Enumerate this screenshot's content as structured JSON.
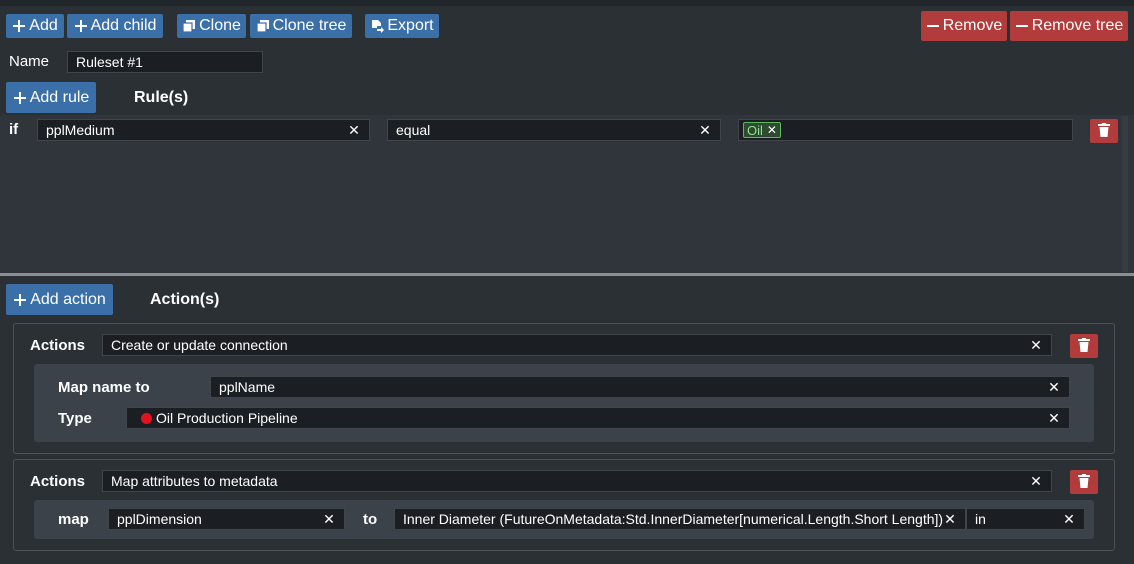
{
  "toolbar": {
    "add": "Add",
    "add_child": "Add child",
    "clone": "Clone",
    "clone_tree": "Clone tree",
    "export": "Export",
    "remove": "Remove",
    "remove_tree": "Remove tree"
  },
  "name": {
    "label": "Name",
    "value": "Ruleset #1"
  },
  "rules": {
    "add_button": "Add rule",
    "heading": "Rule(s)",
    "items": [
      {
        "keyword": "if",
        "field": "pplMedium",
        "operator": "equal",
        "values": [
          "Oil"
        ]
      }
    ]
  },
  "actions": {
    "add_button": "Add action",
    "heading": "Action(s)",
    "items": [
      {
        "label": "Actions",
        "type": "Create or update connection",
        "map_name_label": "Map name to",
        "map_name_value": "pplName",
        "type_label": "Type",
        "type_value": "Oil Production Pipeline"
      },
      {
        "label": "Actions",
        "type": "Map attributes to metadata",
        "map_label": "map",
        "map_source": "pplDimension",
        "to_label": "to",
        "map_target": "Inner Diameter (FutureOnMetadata:Std.InnerDiameter[numerical.Length.Short Length])",
        "unit": "in"
      }
    ]
  },
  "colors": {
    "primary": "#3a6fa8",
    "danger": "#b23b3b",
    "background": "#2b3035",
    "type_dot": "#e8101a"
  },
  "icons": {
    "add": "plus-icon",
    "clone": "copy-icon",
    "export": "export-icon",
    "remove": "minus-icon",
    "delete": "trash-icon",
    "clear": "x-icon"
  }
}
